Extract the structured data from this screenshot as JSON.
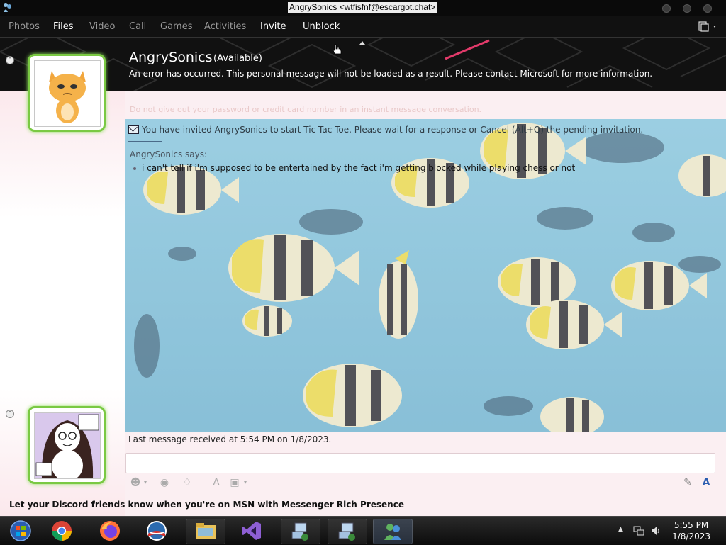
{
  "window": {
    "title": "AngrySonics <wtfisfnf@escargot.chat>"
  },
  "menu": {
    "items": [
      {
        "label": "Photos",
        "active": false
      },
      {
        "label": "Files",
        "active": true
      },
      {
        "label": "Video",
        "active": false
      },
      {
        "label": "Call",
        "active": false
      },
      {
        "label": "Games",
        "active": false
      },
      {
        "label": "Activities",
        "active": false
      },
      {
        "label": "Invite",
        "active": true
      },
      {
        "label": "Unblock",
        "active": true
      }
    ]
  },
  "contact": {
    "name": "AngrySonics",
    "status": "(Available)",
    "personal_message": "An error has occurred. This personal message will not be loaded as a result. Please contact Microsoft for more information."
  },
  "conversation": {
    "faded_notice": "Do not give out your password or credit card number in an instant message conversation.",
    "invite_notice": "You have invited AngrySonics to start Tic Tac Toe. Please wait for a response or Cancel (Alt+Q) the pending invitation.",
    "sender_line": "AngrySonics says:",
    "message": "i can't tell if i'm supposed to be entertained by the fact i'm getting blocked while playing chess or not",
    "last_received": "Last message received at 5:54 PM on 1/8/2023."
  },
  "footer": {
    "ad_text": "Let your Discord friends know when you're on MSN with Messenger Rich Presence"
  },
  "taskbar": {
    "time": "5:55 PM",
    "date": "1/8/2023"
  },
  "icons": {
    "status": "messenger-buddy-icon",
    "envelope": "envelope-icon"
  },
  "colors": {
    "frame_green": "#7ac943",
    "header_bg": "#111111",
    "body_bg": "#fbeff2"
  }
}
